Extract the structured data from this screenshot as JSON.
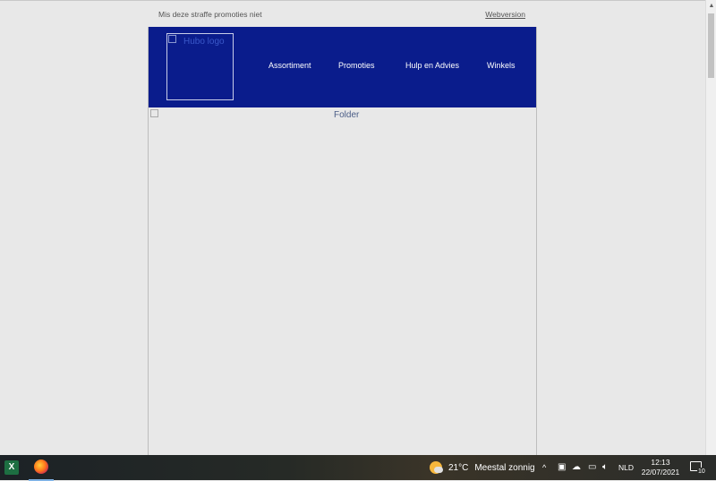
{
  "email": {
    "preheader_text": "Mis deze straffe promoties niet",
    "webversion_link": "Webversion",
    "logo_alt": "Hubo logo",
    "nav": [
      {
        "label": "Assortiment"
      },
      {
        "label": "Promoties"
      },
      {
        "label": "Hulp en Advies"
      },
      {
        "label": "Winkels"
      }
    ],
    "folder_alt": "Folder",
    "colors": {
      "header_bg": "#0a1c8c",
      "page_bg": "#e8e8e8"
    }
  },
  "taskbar": {
    "apps": [
      {
        "name": "Excel",
        "icon": "excel-icon",
        "glyph": "X"
      },
      {
        "name": "Firefox",
        "icon": "firefox-icon"
      }
    ],
    "weather": {
      "icon": "partly-sunny-icon",
      "temperature": "21°C",
      "condition": "Meestal zonnig"
    },
    "tray": {
      "chevron": "^",
      "language": "NLD"
    },
    "clock": {
      "time": "12:13",
      "date": "22/07/2021"
    },
    "notifications": {
      "count": "10"
    }
  }
}
